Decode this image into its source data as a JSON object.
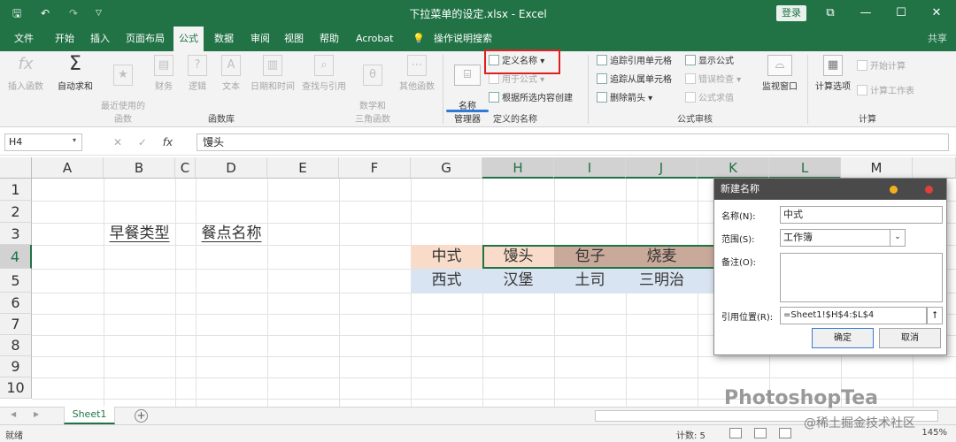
{
  "window": {
    "title": "下拉菜单的设定.xlsx - Excel",
    "signin": "登录",
    "qa_save": "🖫",
    "qa_undo": "↶",
    "qa_redo": "↷",
    "minimize": "—",
    "restore": "☐",
    "close": "✕",
    "ribbon_display": "⧉"
  },
  "tabs": [
    "文件",
    "开始",
    "插入",
    "页面布局",
    "公式",
    "数据",
    "审阅",
    "视图",
    "帮助",
    "Acrobat",
    "操作说明搜索"
  ],
  "share": "共享",
  "ribbon": {
    "insert_function": "插入函数",
    "autosum": "自动求和",
    "recent": "最近使用的\n函数",
    "financial": "财务",
    "logical": "逻辑",
    "text": "文本",
    "datetime": "日期和时间",
    "lookup": "查找与引用",
    "math": "数学和\n三角函数",
    "more": "其他函数",
    "group_library": "函数库",
    "name_manager": "名称\n管理器",
    "define_name": "定义名称",
    "use_in_formula": "用于公式",
    "create_from_selection": "根据所选内容创建",
    "group_defined_names": "定义的名称",
    "trace_precedents": "追踪引用单元格",
    "trace_dependents": "追踪从属单元格",
    "remove_arrows": "删除箭头",
    "show_formulas": "显示公式",
    "error_checking": "错误检查",
    "evaluate_formula": "公式求值",
    "watch_window": "监视窗口",
    "group_auditing": "公式审核",
    "calc_options": "计算选项",
    "calc_now": "开始计算",
    "calc_sheet": "计算工作表",
    "group_calc": "计算"
  },
  "formula_bar": {
    "name_box": "H4",
    "content": "馒头"
  },
  "columns": [
    "A",
    "B",
    "C",
    "D",
    "E",
    "F",
    "G",
    "H",
    "I",
    "J",
    "K",
    "L",
    "M"
  ],
  "rows": [
    "1",
    "2",
    "3",
    "4",
    "5",
    "6",
    "7",
    "8",
    "9",
    "10"
  ],
  "cells": {
    "B3": "早餐类型",
    "D3": "餐点名称",
    "G4": "中式",
    "H4": "馒头",
    "I4": "包子",
    "J4": "烧麦",
    "G5": "西式",
    "H5": "汉堡",
    "I5": "土司",
    "J5": "三明治"
  },
  "sheet_tab": "Sheet1",
  "status": {
    "ready": "就绪",
    "count": "计数: 5",
    "zoom": "145%"
  },
  "dialog": {
    "title": "新建名称",
    "name_label": "名称(N):",
    "name_value": "中式",
    "scope_label": "范围(S):",
    "scope_value": "工作簿",
    "comment_label": "备注(O):",
    "refers_label": "引用位置(R):",
    "refers_value": "=Sheet1!$H$4:$L$4",
    "ok": "确定",
    "cancel": "取消"
  },
  "watermark": "PhotoshopTea",
  "watermark2": "@稀土掘金技术社区",
  "colors": {
    "excel_green": "#217346",
    "row4_first": "#f8dcc9",
    "row4_rest": "#c9a999",
    "row5": "#d9e4f2",
    "highlight_red": "#e02020"
  }
}
